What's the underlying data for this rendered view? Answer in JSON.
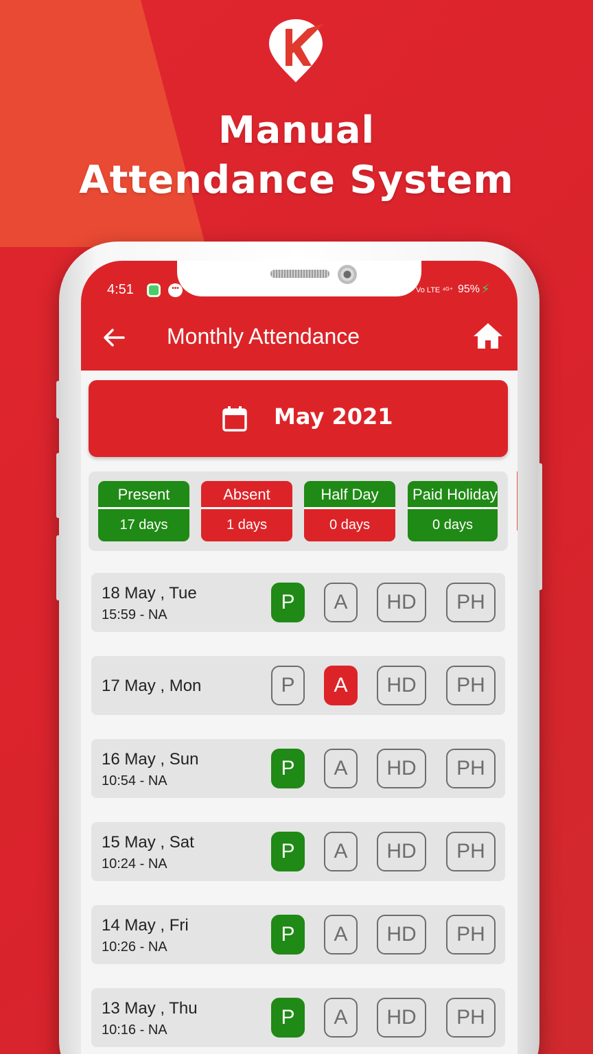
{
  "promo": {
    "headline_line1": "Manual",
    "headline_line2": "Attendance System"
  },
  "status_bar": {
    "time": "4:51",
    "network": "Vo LTE ⁴ᴳ⁺",
    "battery": "95%"
  },
  "app_bar": {
    "title": "Monthly Attendance"
  },
  "month_selector": {
    "label": "May 2021"
  },
  "summary": [
    {
      "label": "Present",
      "value": "17 days",
      "color": "#1f8a15"
    },
    {
      "label": "Absent",
      "value": "1 days",
      "color": "#dc2428"
    },
    {
      "label": "Half Day",
      "value": "0 days",
      "color": "#dc2428"
    },
    {
      "label": "Paid Holiday",
      "value": "0 days",
      "color": "#1f8a15"
    }
  ],
  "options": {
    "p": "P",
    "a": "A",
    "hd": "HD",
    "ph": "PH"
  },
  "rows": [
    {
      "date": "18 May , Tue",
      "time": "15:59 - NA",
      "selected": "P"
    },
    {
      "date": "17 May , Mon",
      "time": "",
      "selected": "A"
    },
    {
      "date": "16 May , Sun",
      "time": "10:54 - NA",
      "selected": "P"
    },
    {
      "date": "15 May , Sat",
      "time": "10:24 - NA",
      "selected": "P"
    },
    {
      "date": "14 May , Fri",
      "time": "10:26 - NA",
      "selected": "P"
    },
    {
      "date": "13 May , Thu",
      "time": "10:16 - NA",
      "selected": "P"
    }
  ],
  "colors": {
    "brand_red": "#dc2428",
    "present_green": "#1f8a15"
  }
}
